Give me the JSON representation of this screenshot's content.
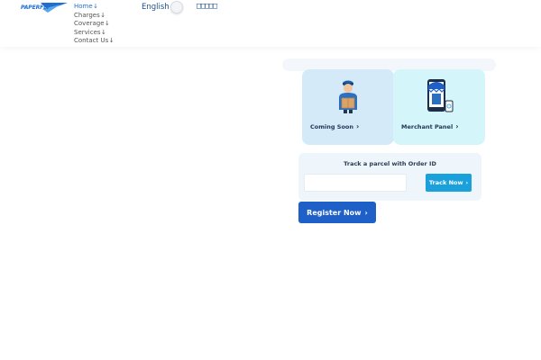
{
  "logo": {
    "text": "PAPERFLY"
  },
  "nav": {
    "items": [
      {
        "label": "Home",
        "arrow": "↓",
        "active": true
      },
      {
        "label": "Charges",
        "arrow": "↓"
      },
      {
        "label": "Coverage",
        "arrow": "↓"
      },
      {
        "label": "Services",
        "arrow": "↓"
      },
      {
        "label": "Contact Us",
        "arrow": "↓"
      }
    ]
  },
  "language": {
    "current": "English",
    "alternate": "□□□□□",
    "toggle_icon": "toggle-switch"
  },
  "cards": {
    "coming_soon": {
      "label": "Coming Soon",
      "chevron": "›",
      "icon": "delivery-man-icon"
    },
    "merchant_panel": {
      "label": "Merchant Panel",
      "chevron": "›",
      "icon": "shop-phone-icon"
    }
  },
  "track": {
    "title": "Track a parcel with Order ID",
    "input_value": "",
    "button_label": "Track Now",
    "button_chevron": "›"
  },
  "register": {
    "label": "Register Now",
    "chevron": "›"
  },
  "colors": {
    "brand": "#1f6fd0",
    "card_coming": "#d4eaf8",
    "card_merchant": "#d4f6fb",
    "track_button": "#1aa0db",
    "register_button": "#1f5fc8"
  }
}
